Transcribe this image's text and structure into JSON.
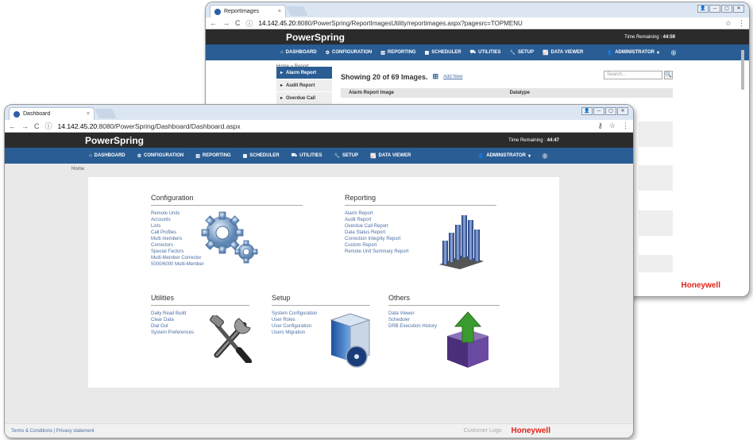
{
  "back": {
    "tab_title": "ReportImages",
    "url_host": "14.142.45.20",
    "url_rest": ":8080/PowerSpring/ReportImagesUtility/reportimages.aspx?pagesrc=TOPMENU",
    "brand": "PowerSpring",
    "time_label": "Time Remaining : ",
    "time_value": "44:59",
    "nav": [
      "DASHBOARD",
      "CONFIGURATION",
      "REPORTING",
      "SCHEDULER",
      "UTILITIES",
      "SETUP",
      "DATA VIEWER"
    ],
    "admin": "ADMINISTRATOR",
    "breadcrumb": "Home » Report",
    "side": [
      "Alarm Report",
      "Audit Report",
      "Overdue Call"
    ],
    "showing": "Showing 20 of 69 Images.",
    "add_new": "Add New",
    "search_placeholder": "Search...",
    "col1": "Alarm Report Image",
    "col2": "Datatype",
    "footer_brand": "Honeywell"
  },
  "front": {
    "tab_title": "Dashboard",
    "url_host": "14.142.45.20",
    "url_rest": ":8080/PowerSpring/Dashboard/Dashboard.aspx",
    "brand": "PowerSpring",
    "time_label": "Time Remaining : ",
    "time_value": "44:47",
    "nav": [
      "DASHBOARD",
      "CONFIGURATION",
      "REPORTING",
      "SCHEDULER",
      "UTILITIES",
      "SETUP",
      "DATA VIEWER"
    ],
    "admin": "ADMINISTRATOR",
    "breadcrumb": "Home",
    "sections": {
      "configuration": {
        "title": "Configuration",
        "links": [
          "Remote Units",
          "Accounts",
          "Lists",
          "Call Profiles",
          "Multi members",
          "Correctors",
          "Special Factors",
          "Multi-Member Corrector",
          "5000/6000 Multi-Member"
        ]
      },
      "reporting": {
        "title": "Reporting",
        "links": [
          "Alarm Report",
          "Audit Report",
          "Overdue Call Report",
          "Data Status Report",
          "Correction Integrity Report",
          "Custom Report",
          "Remote Unit Summary Report"
        ]
      },
      "utilities": {
        "title": "Utilities",
        "links": [
          "Daily Read Build",
          "Clear Data",
          "Dial Out",
          "System Preferences"
        ]
      },
      "setup": {
        "title": "Setup",
        "links": [
          "System Configuration",
          "User Roles",
          "User Configuration",
          "Users Migration"
        ]
      },
      "others": {
        "title": "Others",
        "links": [
          "Data Viewer",
          "Scheduler",
          "DRB Execution History"
        ]
      }
    },
    "footer_links": "Terms & Conditions  | Privacy statement",
    "customer_logo": "Customer Logo",
    "footer_brand": "Honeywell"
  },
  "colors": {
    "nav": "#2a5d94",
    "topbar": "#2b2b2b",
    "link": "#4a6fa5",
    "honeywell": "#e2231a"
  }
}
